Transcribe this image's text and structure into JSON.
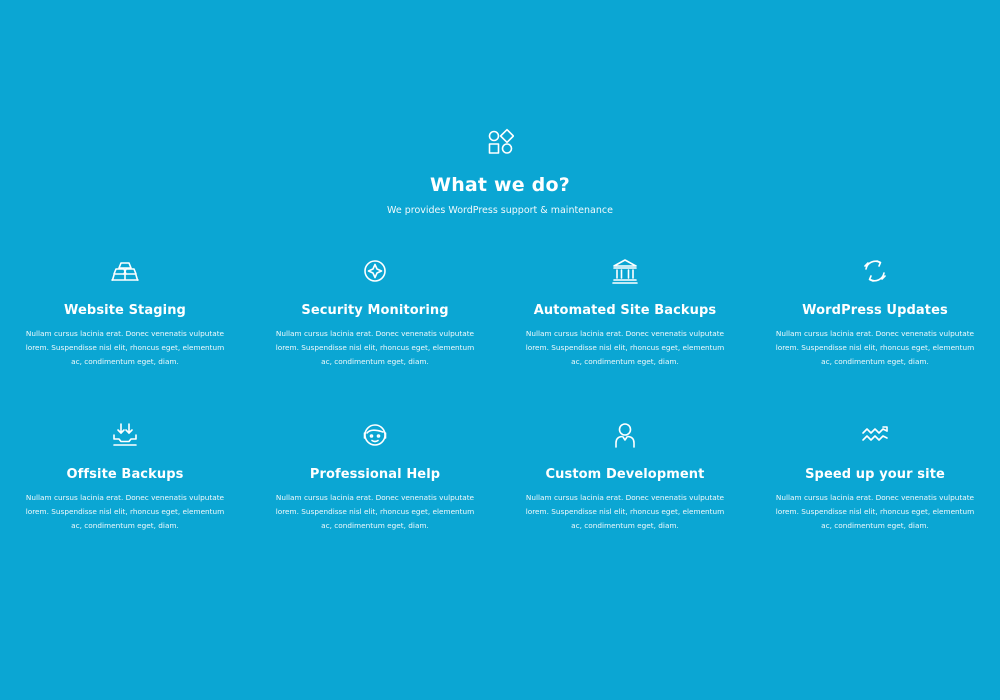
{
  "page": {
    "background_color": "#0ba6d3",
    "text_color": "#ffffff"
  },
  "header": {
    "icon": "shapes-icon",
    "title": "What we do?",
    "subtitle": "We provides WordPress support & maintenance"
  },
  "services": [
    {
      "icon": "gold-bars-icon",
      "title": "Website Staging",
      "description": "Nullam cursus lacinia erat. Donec venenatis vulputate lorem. Suspendisse nisl elit, rhoncus eget, elementum ac, condimentum eget, diam."
    },
    {
      "icon": "compass-icon",
      "title": "Security Monitoring",
      "description": "Nullam cursus lacinia erat. Donec venenatis vulputate lorem. Suspendisse nisl elit, rhoncus eget, elementum ac, condimentum eget, diam."
    },
    {
      "icon": "bank-icon",
      "title": "Automated Site Backups",
      "description": "Nullam cursus lacinia erat. Donec venenatis vulputate lorem. Suspendisse nisl elit, rhoncus eget, elementum ac, condimentum eget, diam."
    },
    {
      "icon": "refresh-icon",
      "title": "WordPress Updates",
      "description": "Nullam cursus lacinia erat. Donec venenatis vulputate lorem. Suspendisse nisl elit, rhoncus eget, elementum ac, condimentum eget, diam."
    },
    {
      "icon": "download-tray-icon",
      "title": "Offsite Backups",
      "description": "Nullam cursus lacinia erat. Donec venenatis vulputate lorem. Suspendisse nisl elit, rhoncus eget, elementum ac, condimentum eget, diam."
    },
    {
      "icon": "support-agent-icon",
      "title": "Professional Help",
      "description": "Nullam cursus lacinia erat. Donec venenatis vulputate lorem. Suspendisse nisl elit, rhoncus eget, elementum ac, condimentum eget, diam."
    },
    {
      "icon": "person-icon",
      "title": "Custom Development",
      "description": "Nullam cursus lacinia erat. Donec venenatis vulputate lorem. Suspendisse nisl elit, rhoncus eget, elementum ac, condimentum eget, diam."
    },
    {
      "icon": "speed-waves-icon",
      "title": "Speed up your site",
      "description": "Nullam cursus lacinia erat. Donec venenatis vulputate lorem. Suspendisse nisl elit, rhoncus eget, elementum ac, condimentum eget, diam."
    }
  ]
}
